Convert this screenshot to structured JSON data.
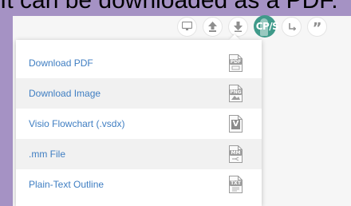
{
  "caption": "It can be downloaded as a PDF.",
  "toolbar": {
    "avatar_initials": "CP/S",
    "quote_glyph": "”"
  },
  "download_menu": {
    "items": [
      {
        "label": "Download PDF",
        "icon_tag": "PDF"
      },
      {
        "label": "Download Image",
        "icon_tag": "PNG"
      },
      {
        "label": "Visio Flowchart (.vsdx)",
        "icon_tag": "V"
      },
      {
        "label": ".mm File",
        "icon_tag": "MM"
      },
      {
        "label": "Plain-Text Outline",
        "icon_tag": "TXT"
      }
    ]
  }
}
